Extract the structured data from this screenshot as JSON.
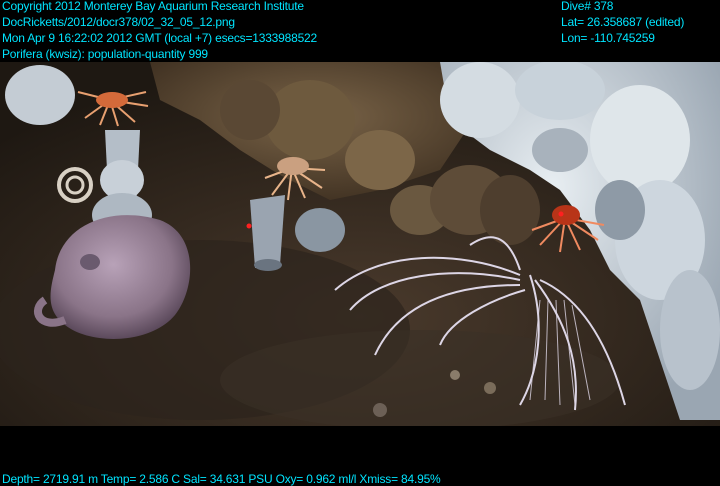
{
  "overlay": {
    "copyright": "Copyright 2012 Monterey Bay Aquarium Research Institute",
    "image_path": "DocRicketts/2012/docr378/02_32_05_12.png",
    "timestamp": "Mon Apr  9 16:22:02 2012 GMT (local +7)  esecs=1333988522",
    "annotation": "Porifera (kwsiz): population-quantity 999",
    "dive": "Dive# 378",
    "lat": "Lat= 26.358687 (edited)",
    "lon": "Lon= -110.745259",
    "sensors": "Depth= 2719.91 m  Temp= 2.586 C  Sal= 34.631 PSU  Oxy= 0.962 ml/l  Xmiss= 84.95%",
    "text_color": "#00e5ff"
  }
}
